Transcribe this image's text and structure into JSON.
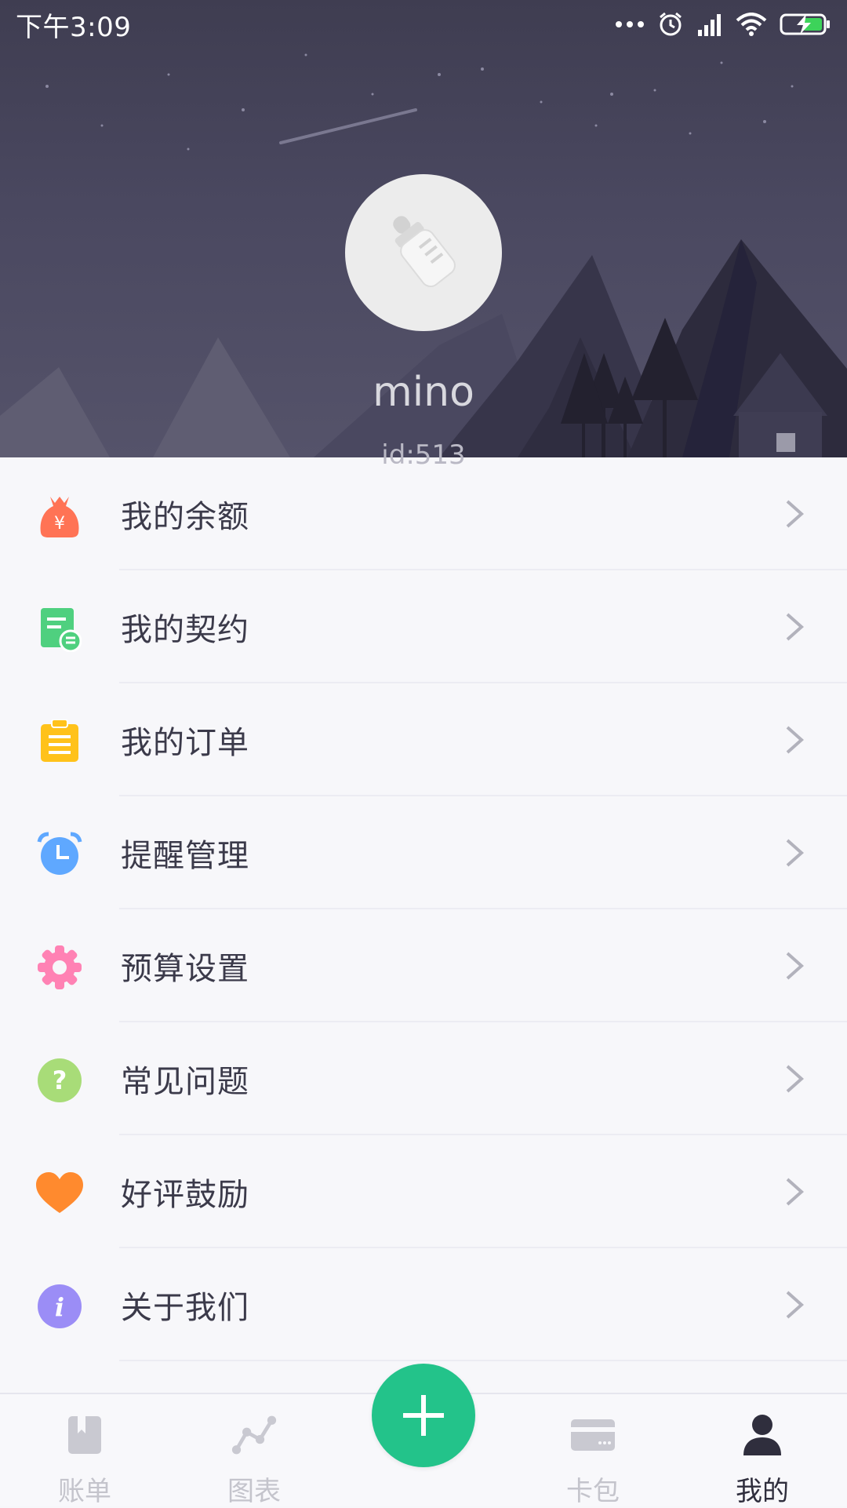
{
  "status_bar": {
    "time": "下午3:09",
    "icons": [
      "more-dots-icon",
      "alarm-icon",
      "signal-icon",
      "wifi-icon",
      "battery-charging-icon"
    ]
  },
  "profile": {
    "username": "mino",
    "user_id": "id:513"
  },
  "menu": {
    "items": [
      {
        "label": "我的余额",
        "icon": "money-bag-icon",
        "color": "#ff7355"
      },
      {
        "label": "我的契约",
        "icon": "contract-icon",
        "color": "#4fd07f"
      },
      {
        "label": "我的订单",
        "icon": "clipboard-icon",
        "color": "#ffc21a"
      },
      {
        "label": "提醒管理",
        "icon": "alarm-clock-icon",
        "color": "#5fa8ff"
      },
      {
        "label": "预算设置",
        "icon": "gear-icon",
        "color": "#ff82b4"
      },
      {
        "label": "常见问题",
        "icon": "question-icon",
        "color": "#a8dc78"
      },
      {
        "label": "好评鼓励",
        "icon": "heart-icon",
        "color": "#ff8a2e"
      },
      {
        "label": "关于我们",
        "icon": "info-icon",
        "color": "#9b8df6"
      }
    ]
  },
  "tabs": [
    {
      "label": "账单",
      "icon": "bill-book-icon",
      "active": false
    },
    {
      "label": "图表",
      "icon": "chart-icon",
      "active": false
    },
    {
      "label": "卡包",
      "icon": "card-icon",
      "active": false
    },
    {
      "label": "我的",
      "icon": "person-icon",
      "active": true
    }
  ],
  "fab": {
    "icon": "plus-icon",
    "color": "#23c38a"
  }
}
